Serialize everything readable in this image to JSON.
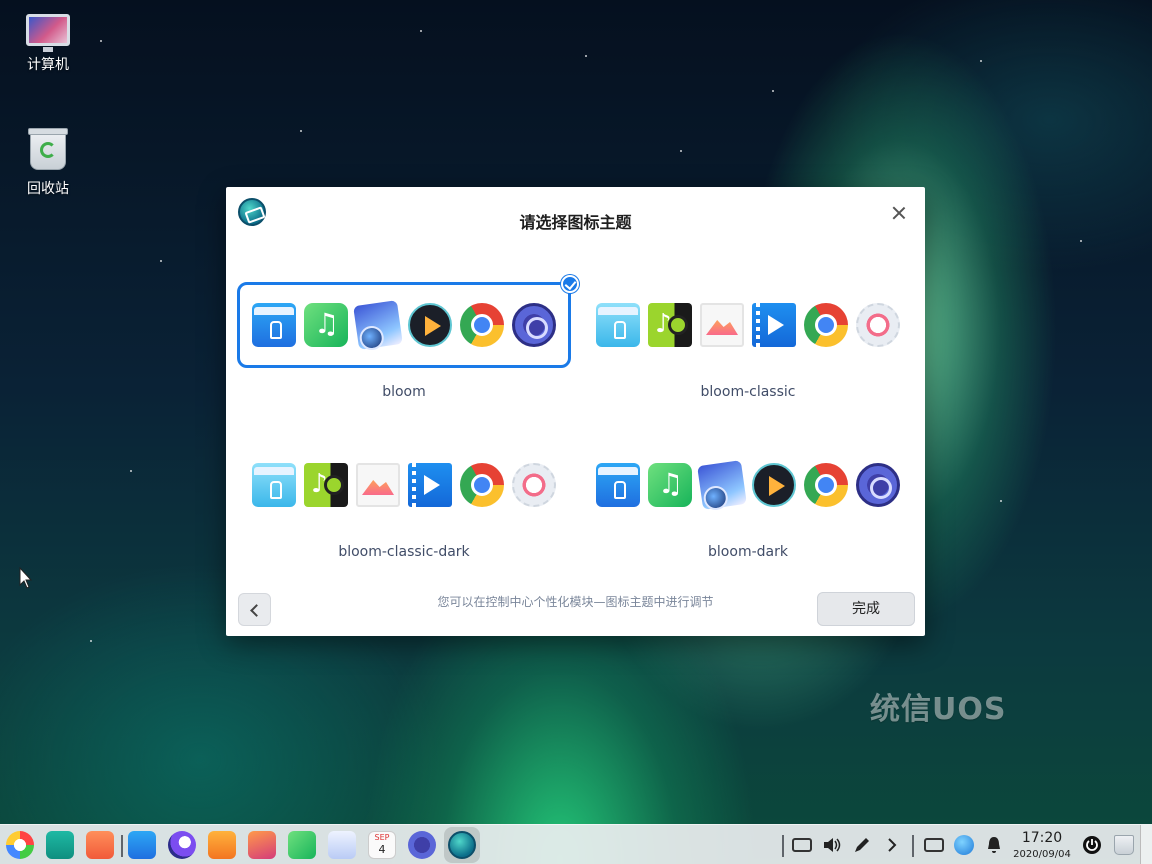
{
  "desktop": {
    "icons": [
      {
        "label": "计算机",
        "icon": "computer-icon"
      },
      {
        "label": "回收站",
        "icon": "trash-icon"
      }
    ],
    "watermark": "统信UOS"
  },
  "dialog": {
    "title": "请选择图标主题",
    "themes": [
      {
        "name": "bloom",
        "selected": true
      },
      {
        "name": "bloom-classic",
        "selected": false
      },
      {
        "name": "bloom-classic-dark",
        "selected": false
      },
      {
        "name": "bloom-dark",
        "selected": false
      }
    ],
    "hint": "您可以在控制中心个性化模块—图标主题中进行调节",
    "done_label": "完成",
    "accent": "#1a7ae8"
  },
  "taskbar": {
    "apps": [
      "launcher-icon",
      "multitask-view-icon",
      "app-store-icon",
      "file-manager-icon",
      "browser-icon",
      "app-market-icon",
      "image-viewer-icon",
      "music-icon",
      "document-viewer-icon",
      "calendar-icon",
      "control-center-icon",
      "welcome-app-icon"
    ],
    "calendar_month": "SEP",
    "calendar_day": "4",
    "clock_time": "17:20",
    "clock_date": "2020/09/04"
  }
}
